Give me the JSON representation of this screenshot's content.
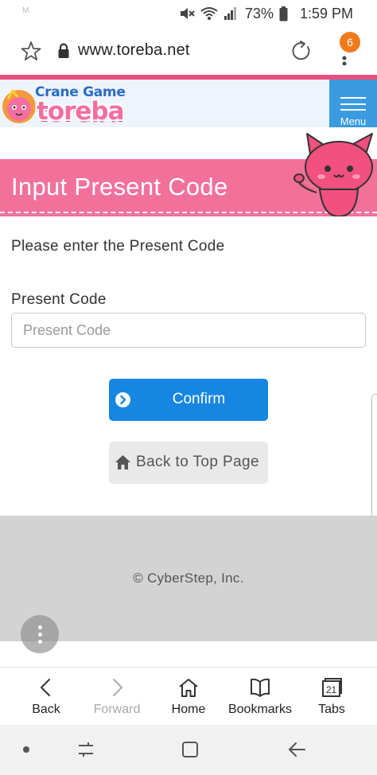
{
  "status_bar": {
    "left_text": "M",
    "battery": "73%",
    "time": "1:59 PM"
  },
  "browser": {
    "url": "www.toreba.net",
    "tab_badge_count": "6"
  },
  "site_header": {
    "logo_top": "Crane Game",
    "logo_bottom": "toreba",
    "menu_label": "Menu"
  },
  "page": {
    "title": "Input Present Code",
    "instruction": "Please enter the Present Code",
    "field_label": "Present Code",
    "field_placeholder": "Present Code",
    "field_value": "",
    "confirm_label": "Confirm",
    "back_label": "Back to Top Page"
  },
  "footer": {
    "copyright": "© CyberStep, Inc."
  },
  "toolbar": {
    "items": [
      {
        "label": "Back",
        "icon": "chevron-left-icon",
        "enabled": true
      },
      {
        "label": "Forward",
        "icon": "chevron-right-icon",
        "enabled": false
      },
      {
        "label": "Home",
        "icon": "home-icon",
        "enabled": true
      },
      {
        "label": "Bookmarks",
        "icon": "bookmarks-icon",
        "enabled": true
      },
      {
        "label": "Tabs",
        "icon": "tabs-icon",
        "enabled": true,
        "count": "21"
      }
    ]
  },
  "colors": {
    "accent_pink": "#f2719b",
    "header_line": "#ea4f7e",
    "menu_blue": "#3a9be0",
    "confirm_blue": "#1686e0",
    "footer_gray": "#d3d3d3"
  }
}
